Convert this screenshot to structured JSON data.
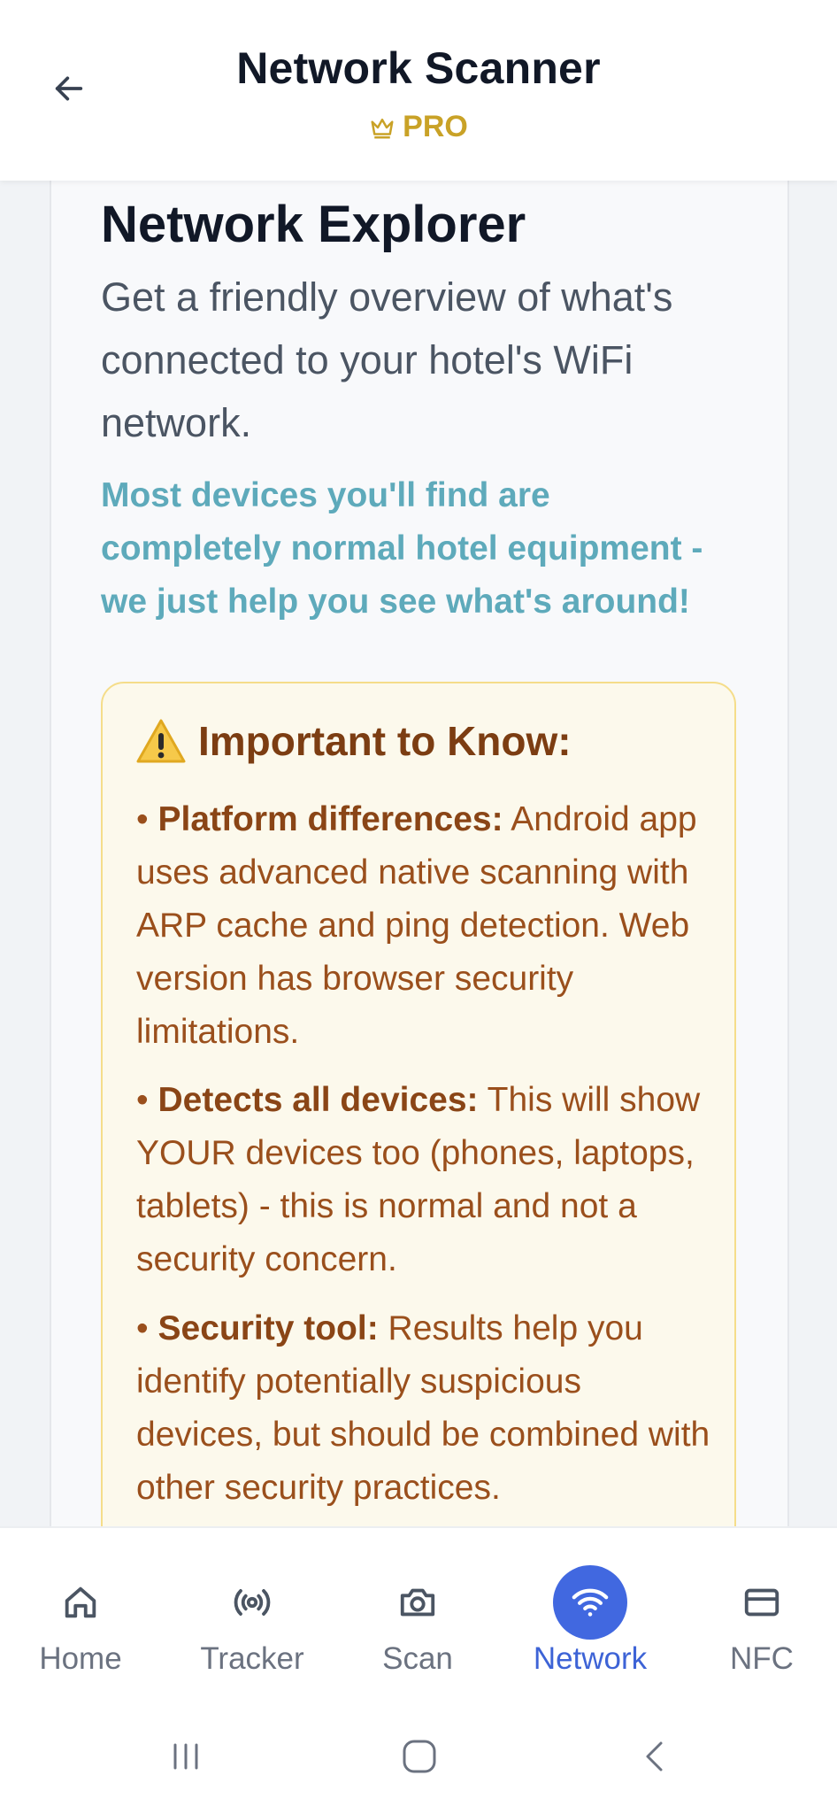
{
  "header": {
    "title": "Network Scanner",
    "badge": "PRO",
    "back_icon": "arrow-left-icon",
    "badge_icon": "crown-icon",
    "badge_color": "#c9a227"
  },
  "explorer": {
    "title": "Network Explorer",
    "description": "Get a friendly overview of what's connected to your hotel's WiFi network.",
    "note": "Most devices you'll find are completely normal hotel equipment - we just help you see what's around!"
  },
  "warning": {
    "icon": "warning-icon",
    "title": "Important to Know:",
    "items": [
      {
        "bullet": "•",
        "label": "Platform differences:",
        "text": "Android app uses advanced native scanning with ARP cache and ping detection. Web version has browser security limitations."
      },
      {
        "bullet": "•",
        "label": "Detects all devices:",
        "text": "This will show YOUR devices too (phones, laptops, tablets) - this is normal and not a security concern."
      },
      {
        "bullet": "•",
        "label": "Security tool:",
        "text": "Results help you identify potentially suspicious devices, but should be combined with other security practices."
      }
    ]
  },
  "bottom_nav": {
    "active": "Network",
    "active_color": "#4168e0",
    "items": [
      {
        "label": "Home",
        "icon": "home-icon"
      },
      {
        "label": "Tracker",
        "icon": "broadcast-icon"
      },
      {
        "label": "Scan",
        "icon": "camera-icon"
      },
      {
        "label": "Network",
        "icon": "wifi-icon"
      },
      {
        "label": "NFC",
        "icon": "card-icon"
      }
    ]
  },
  "system_nav": {
    "items": [
      "recent-apps-icon",
      "home-circle-icon",
      "back-chevron-icon"
    ]
  }
}
